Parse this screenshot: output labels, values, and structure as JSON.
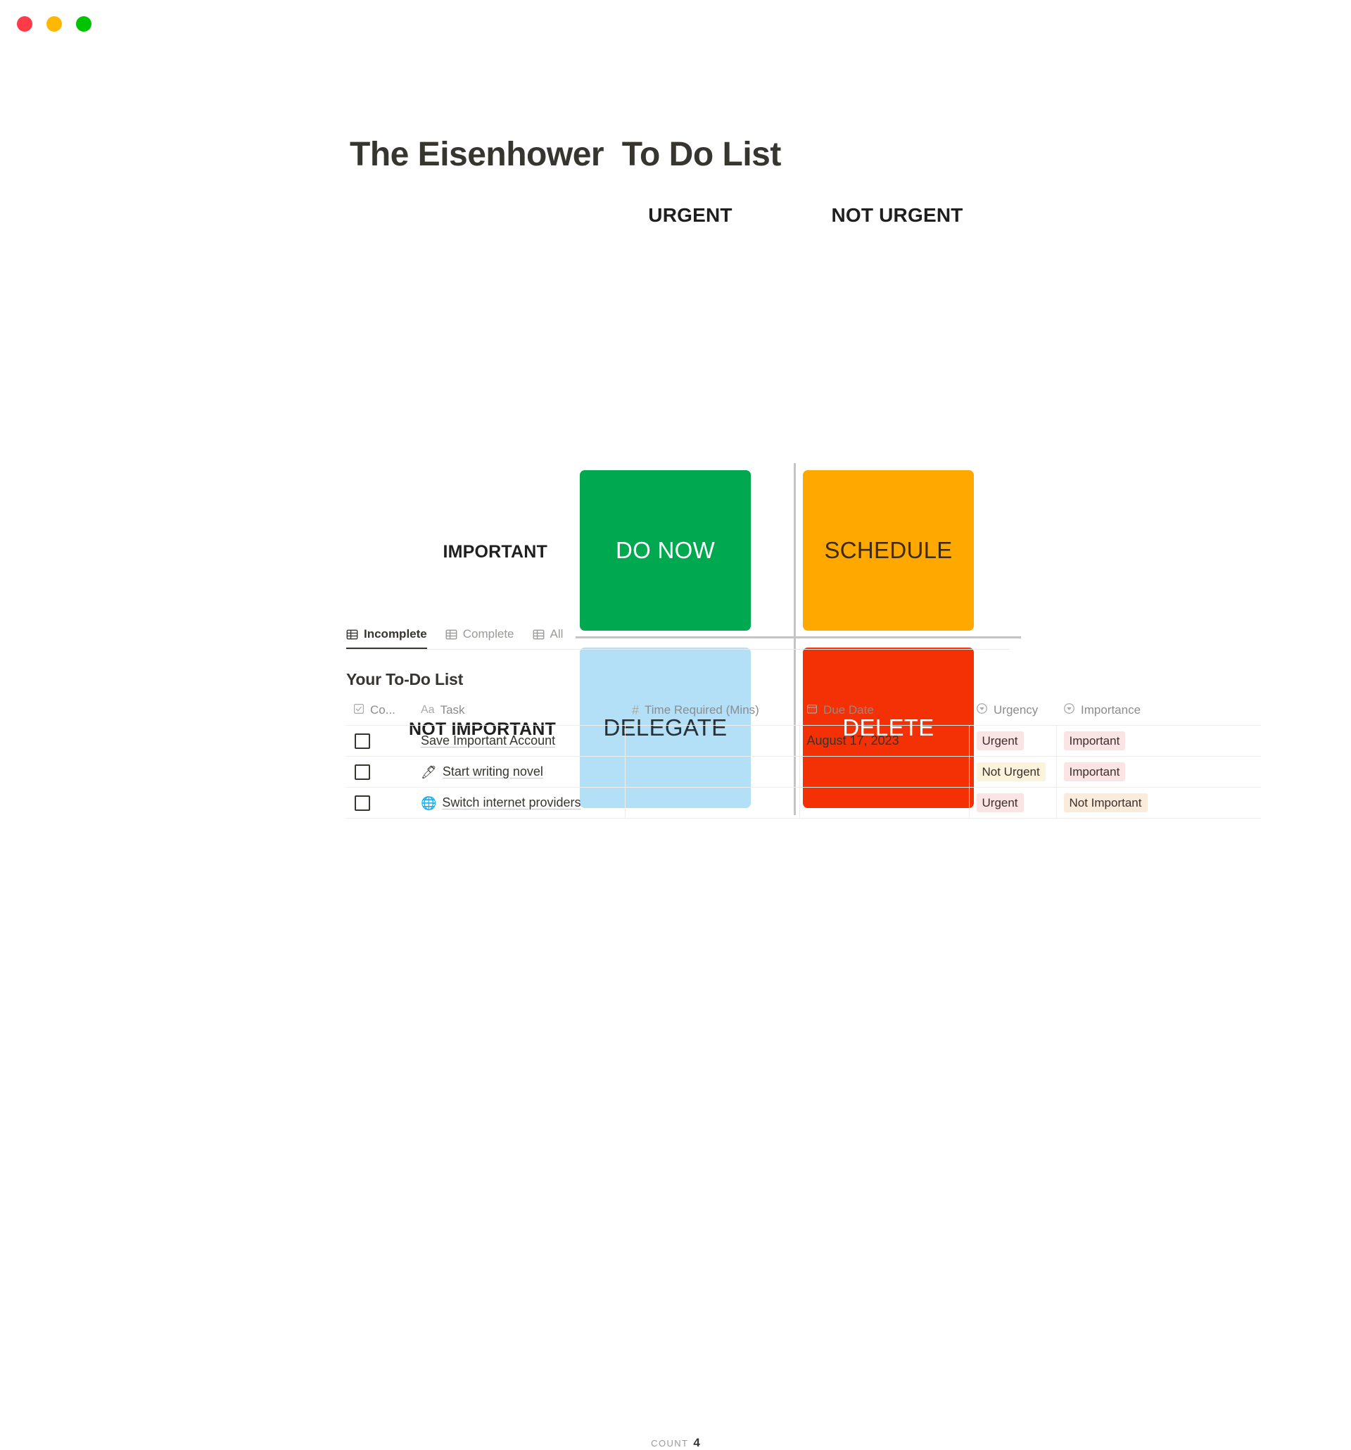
{
  "window": {
    "controls": [
      {
        "name": "close",
        "color": "#ff3b47"
      },
      {
        "name": "minimize",
        "color": "#ffb700"
      },
      {
        "name": "maximize",
        "color": "#00c400"
      }
    ]
  },
  "page": {
    "title": "The Eisenhower  To Do List"
  },
  "matrix": {
    "columns": [
      {
        "label": "URGENT"
      },
      {
        "label": "NOT URGENT"
      }
    ],
    "rows": [
      {
        "label": "IMPORTANT"
      },
      {
        "label": "NOT IMPORTANT"
      }
    ],
    "quadrants": [
      {
        "key": "do_now",
        "label": "DO NOW",
        "bg": "#00a94f",
        "fg": "#ffffff"
      },
      {
        "key": "schedule",
        "label": "SCHEDULE",
        "bg": "#ffa800",
        "fg": "#3d2b0a"
      },
      {
        "key": "delegate",
        "label": "DELEGATE",
        "bg": "#b3e0f7",
        "fg": "#25323a"
      },
      {
        "key": "delete",
        "label": "DELETE",
        "bg": "#f43005",
        "fg": "#ffffff"
      }
    ]
  },
  "database": {
    "tabs": [
      {
        "label": "Incomplete",
        "icon": "table-icon",
        "active": true
      },
      {
        "label": "Complete",
        "icon": "table-icon",
        "active": false
      },
      {
        "label": "All",
        "icon": "table-icon",
        "active": false
      }
    ],
    "title": "Your To-Do List",
    "columns": [
      {
        "label": "Co...",
        "icon": "checkbox-icon"
      },
      {
        "label": "Task",
        "icon": "text-aa-icon"
      },
      {
        "label": "Time Required (Mins)",
        "icon": "number-hash-icon"
      },
      {
        "label": "Due Date",
        "icon": "calendar-icon"
      },
      {
        "label": "Urgency",
        "icon": "select-circle-chevron-icon"
      },
      {
        "label": "Importance",
        "icon": "select-circle-chevron-icon"
      }
    ],
    "rows": [
      {
        "checked": false,
        "emoji": "",
        "task": "Save Important Account",
        "time_required": "",
        "due_date": "August 17, 2023",
        "urgency": {
          "label": "Urgent",
          "color": "pink"
        },
        "importance": {
          "label": "Important",
          "color": "pink"
        }
      },
      {
        "checked": false,
        "emoji": "🖊",
        "task": "Start writing novel",
        "time_required": "",
        "due_date": "",
        "urgency": {
          "label": "Not Urgent",
          "color": "yellow"
        },
        "importance": {
          "label": "Important",
          "color": "pink"
        }
      },
      {
        "checked": false,
        "emoji": "🌐",
        "task": "Switch internet providers",
        "time_required": "",
        "due_date": "",
        "urgency": {
          "label": "Urgent",
          "color": "pink"
        },
        "importance": {
          "label": "Not Important",
          "color": "orange"
        }
      }
    ],
    "footer": {
      "count_label": "Count",
      "count_value": "4"
    }
  }
}
